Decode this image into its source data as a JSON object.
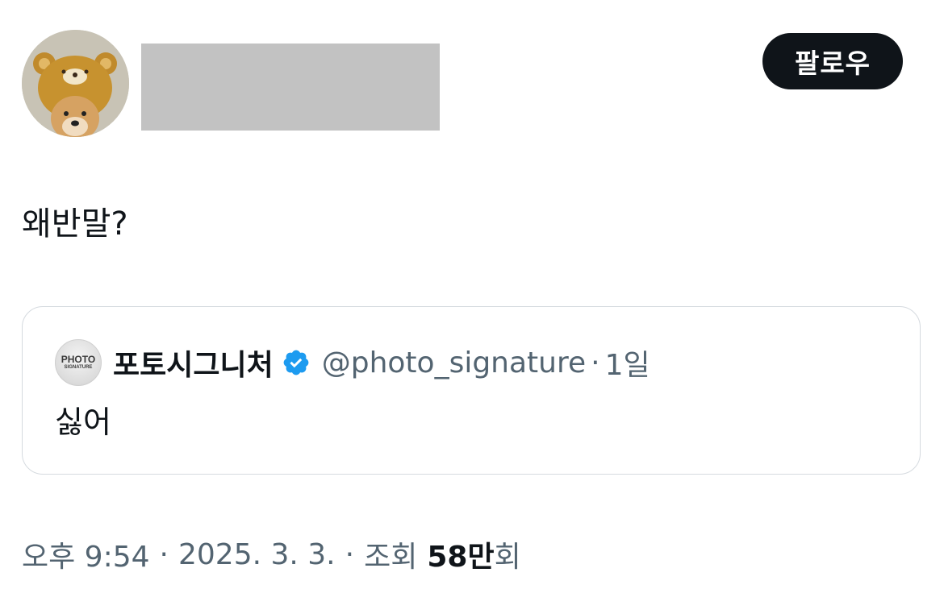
{
  "author": {
    "avatar_icon": "shiba-dog-in-bear-hat-avatar",
    "name_redacted": true
  },
  "follow_button": {
    "label": "팔로우"
  },
  "tweet": {
    "text": "왜반말?"
  },
  "quote": {
    "avatar_line1": "PHOTO",
    "avatar_line2": "SIGNATURE",
    "display_name": "포토시그니처",
    "verified_icon": "verified-badge-icon",
    "handle": "@photo_signature",
    "separator": "·",
    "time": "1일",
    "text": "싫어"
  },
  "meta": {
    "time": "오후 9:54",
    "sep1": "·",
    "date": "2025. 3. 3.",
    "sep2": "·",
    "views_label": "조회",
    "views_number": "58만",
    "views_suffix": "회"
  },
  "colors": {
    "text_primary": "#0f1419",
    "text_secondary": "#536471",
    "verified_blue": "#1d9bf0",
    "border": "#d5dadf",
    "redaction": "#c2c2c2"
  }
}
